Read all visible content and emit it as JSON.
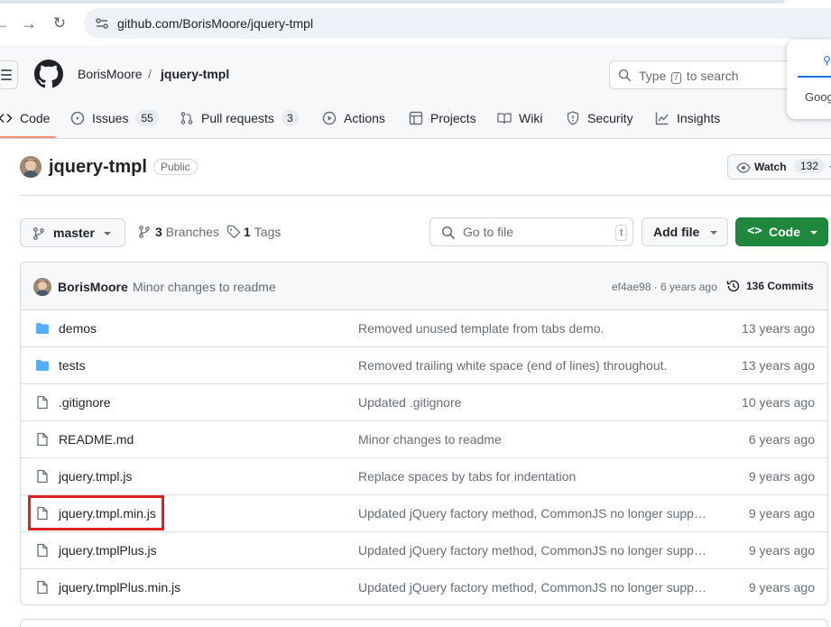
{
  "browser": {
    "url": "github.com/BorisMoore/jquery-tmpl"
  },
  "header": {
    "owner": "BorisMoore",
    "separator": "/",
    "repo": "jquery-tmpl",
    "search_prefix": "Type",
    "search_key": "/",
    "search_suffix": "to search"
  },
  "google_popup": {
    "text": "Goog"
  },
  "tabs": [
    {
      "label": "Code",
      "count": null,
      "icon": "code-icon"
    },
    {
      "label": "Issues",
      "count": "55",
      "icon": "issue-icon"
    },
    {
      "label": "Pull requests",
      "count": "3",
      "icon": "pull-request-icon"
    },
    {
      "label": "Actions",
      "count": null,
      "icon": "play-icon"
    },
    {
      "label": "Projects",
      "count": null,
      "icon": "table-icon"
    },
    {
      "label": "Wiki",
      "count": null,
      "icon": "book-icon"
    },
    {
      "label": "Security",
      "count": null,
      "icon": "shield-icon"
    },
    {
      "label": "Insights",
      "count": null,
      "icon": "graph-icon"
    }
  ],
  "repo": {
    "title": "jquery-tmpl",
    "visibility": "Public",
    "watch_label": "Watch",
    "watch_count": "132"
  },
  "toolbar": {
    "branch": "master",
    "branches_count": "3",
    "branches_label": "Branches",
    "tags_count": "1",
    "tags_label": "Tags",
    "goto_placeholder": "Go to file",
    "goto_key": "t",
    "add_file": "Add file",
    "code_label": "Code"
  },
  "latest_commit": {
    "author": "BorisMoore",
    "message": "Minor changes to readme",
    "hash_age": "ef4ae98 · 6 years ago",
    "commits": "136 Commits"
  },
  "files": [
    {
      "name": "demos",
      "type": "dir",
      "message": "Removed unused template from tabs demo.",
      "age": "13 years ago"
    },
    {
      "name": "tests",
      "type": "dir",
      "message": "Removed trailing white space (end of lines) throughout.",
      "age": "13 years ago"
    },
    {
      "name": ".gitignore",
      "type": "file",
      "message": "Updated .gitignore",
      "age": "10 years ago"
    },
    {
      "name": "README.md",
      "type": "file",
      "message": "Minor changes to readme",
      "age": "6 years ago"
    },
    {
      "name": "jquery.tmpl.js",
      "type": "file",
      "message": "Replace spaces by tabs for indentation",
      "age": "9 years ago"
    },
    {
      "name": "jquery.tmpl.min.js",
      "type": "file",
      "message": "Updated jQuery factory method, CommonJS no longer supp…",
      "age": "9 years ago"
    },
    {
      "name": "jquery.tmplPlus.js",
      "type": "file",
      "message": "Updated jQuery factory method, CommonJS no longer supp…",
      "age": "9 years ago"
    },
    {
      "name": "jquery.tmplPlus.min.js",
      "type": "file",
      "message": "Updated jQuery factory method, CommonJS no longer supp…",
      "age": "9 years ago"
    }
  ],
  "colors": {
    "accent_green": "#1f883d",
    "folder_blue": "#54aeff",
    "highlight_red": "#e01f1f",
    "tab_underline": "#fd8c73"
  }
}
